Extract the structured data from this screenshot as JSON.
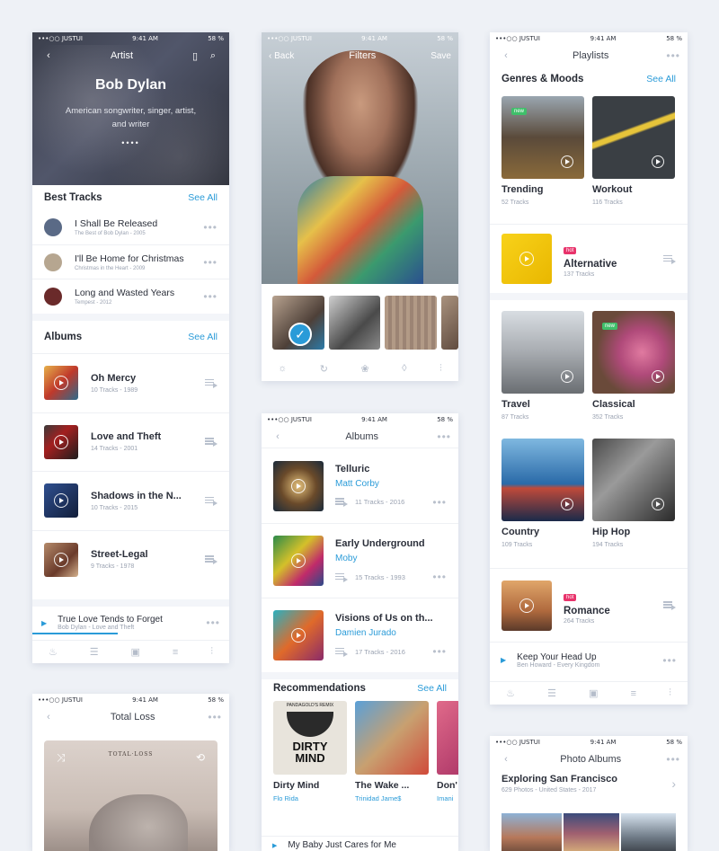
{
  "status": {
    "carrier": "•••○○ JUSTUI",
    "time": "9:41 AM",
    "battery": "58 %"
  },
  "artist": {
    "nav_title": "Artist",
    "name": "Bob Dylan",
    "bio": "American songwriter, singer, artist, and writer",
    "best_tracks_label": "Best Tracks",
    "see_all": "See All",
    "tracks": [
      {
        "title": "I Shall Be Released",
        "sub": "The Best of Bob Dylan - 2005"
      },
      {
        "title": "I'll Be Home for Christmas",
        "sub": "Christmas in the Heart - 2009"
      },
      {
        "title": "Long and Wasted Years",
        "sub": "Tempest - 2012"
      }
    ],
    "albums_label": "Albums",
    "albums": [
      {
        "title": "Oh Mercy",
        "meta": "10 Tracks - 1989"
      },
      {
        "title": "Love and Theft",
        "meta": "14 Tracks - 2001"
      },
      {
        "title": "Shadows in the N...",
        "meta": "10 Tracks - 2015"
      },
      {
        "title": "Street-Legal",
        "meta": "9 Tracks - 1978"
      }
    ],
    "now_playing": {
      "title": "True Love Tends to Forget",
      "sub": "Bob Dylan - Love and Theft"
    }
  },
  "filters": {
    "back": "Back",
    "title": "Filters",
    "save": "Save"
  },
  "albums_screen": {
    "nav_title": "Albums",
    "items": [
      {
        "title": "Telluric",
        "artist": "Matt Corby",
        "meta": "11 Tracks - 2016"
      },
      {
        "title": "Early Underground",
        "artist": "Moby",
        "meta": "15 Tracks - 1993"
      },
      {
        "title": "Visions of Us on th...",
        "artist": "Damien Jurado",
        "meta": "17 Tracks - 2016"
      }
    ],
    "recommendations_label": "Recommendations",
    "see_all": "See All",
    "recs": [
      {
        "title": "Dirty Mind",
        "artist": "Flo Rida",
        "cover_text": "DIRTY MIND",
        "cover_top": "PANDAGOLD'S REMIX"
      },
      {
        "title": "The Wake ...",
        "artist": "Trinidad Jame$"
      },
      {
        "title": "Don'",
        "artist": "Imani"
      }
    ],
    "now_playing": "My Baby Just Cares for Me"
  },
  "playlists": {
    "nav_title": "Playlists",
    "section": "Genres & Moods",
    "see_all": "See All",
    "grid1": [
      {
        "name": "Trending",
        "count": "52 Tracks",
        "badge": "new"
      },
      {
        "name": "Workout",
        "count": "116 Tracks"
      }
    ],
    "alternative": {
      "name": "Alternative",
      "count": "137 Tracks",
      "badge": "hot"
    },
    "grid2": [
      {
        "name": "Travel",
        "count": "87 Tracks"
      },
      {
        "name": "Classical",
        "count": "352 Tracks",
        "badge": "new"
      },
      {
        "name": "Country",
        "count": "109 Tracks"
      },
      {
        "name": "Hip Hop",
        "count": "194 Tracks"
      }
    ],
    "romance": {
      "name": "Romance",
      "count": "264 Tracks",
      "badge": "hot"
    },
    "now_playing": {
      "title": "Keep Your Head Up",
      "sub": "Ben Howard - Every Kingdom"
    }
  },
  "total_loss": {
    "nav_title": "Total Loss",
    "cover_text": "TOTAL·LOSS"
  },
  "photo_albums": {
    "nav_title": "Photo Albums",
    "title": "Exploring San Francisco",
    "meta": "629 Photos - United States - 2017"
  },
  "colors": {
    "accent": "#2a9bd8",
    "hot": "#e8336b",
    "new": "#3fbf6a",
    "yellow": "#f5c400"
  }
}
